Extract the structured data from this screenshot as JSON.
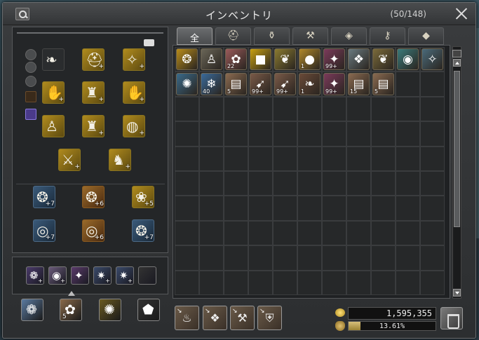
{
  "window": {
    "title": "インベントリ",
    "slot_count": "(50/148)"
  },
  "tabs": [
    {
      "label": "全",
      "icon": "all-tab",
      "active": true
    },
    {
      "label": "",
      "icon": "helmet-icon",
      "glyph": "⛑"
    },
    {
      "label": "",
      "icon": "potion-icon",
      "glyph": "⚱"
    },
    {
      "label": "",
      "icon": "hammer-icon",
      "glyph": "⚒"
    },
    {
      "label": "",
      "icon": "box-icon",
      "glyph": "◈"
    },
    {
      "label": "",
      "icon": "key-icon",
      "glyph": "⚷"
    },
    {
      "label": "",
      "icon": "diamond-icon",
      "glyph": "◆"
    }
  ],
  "inventory_items": [
    {
      "icon": "gold-pile-icon",
      "glyph": "❂",
      "color": "#b88c1a",
      "qty": ""
    },
    {
      "icon": "cloak-icon",
      "glyph": "♙",
      "color": "#6a6658",
      "qty": ""
    },
    {
      "icon": "rose-icon",
      "glyph": "✿",
      "color": "#9a5a5a",
      "qty": "22"
    },
    {
      "icon": "gold-cube-icon",
      "glyph": "■",
      "color": "#c8a010",
      "qty": ""
    },
    {
      "icon": "feather-icon",
      "glyph": "❦",
      "color": "#8a7a30",
      "qty": ""
    },
    {
      "icon": "egg-icon",
      "glyph": "●",
      "color": "#b0882a",
      "qty": "1"
    },
    {
      "icon": "crystal-scroll-icon",
      "glyph": "✦",
      "color": "#7a3a5a",
      "qty": "99+"
    },
    {
      "icon": "scroll-icon",
      "glyph": "❖",
      "color": "#6a7a80",
      "qty": ""
    },
    {
      "icon": "horn-icon",
      "glyph": "❦",
      "color": "#7a6a3a",
      "qty": ""
    },
    {
      "icon": "green-orb-icon",
      "glyph": "◉",
      "color": "#3a7a7a",
      "qty": ""
    },
    {
      "icon": "magic-wand-icon",
      "glyph": "✧",
      "color": "#4a6a7a",
      "qty": ""
    },
    {
      "icon": "pendant-icon",
      "glyph": "✺",
      "color": "#3a6a8a",
      "qty": ""
    },
    {
      "icon": "crystal-icon",
      "glyph": "❄",
      "color": "#3a6a9a",
      "qty": "40"
    },
    {
      "icon": "paper-icon",
      "glyph": "▤",
      "color": "#8a6a50",
      "qty": "5"
    },
    {
      "icon": "arrow-stick-icon",
      "glyph": "➹",
      "color": "#7a5a48",
      "qty": "99+"
    },
    {
      "icon": "arrow-stick-icon",
      "glyph": "➹",
      "color": "#7a5a48",
      "qty": "99+"
    },
    {
      "icon": "leaf-icon",
      "glyph": "❧",
      "color": "#6a4a38",
      "qty": "1"
    },
    {
      "icon": "crystal-scroll-icon",
      "glyph": "✦",
      "color": "#7a3a5a",
      "qty": "99+"
    },
    {
      "icon": "paper-icon",
      "glyph": "▤",
      "color": "#8a6a50",
      "qty": "15"
    },
    {
      "icon": "paper-icon",
      "glyph": "▤",
      "color": "#8a6a50",
      "qty": "5"
    }
  ],
  "equipment": [
    {
      "icon": "wings-icon",
      "glyph": "❧",
      "style": "empty",
      "tag": ""
    },
    {
      "icon": "helmet-icon",
      "glyph": "⛑",
      "style": "gold",
      "tag": "+"
    },
    {
      "icon": "shoulder-armor-icon",
      "glyph": "✧",
      "style": "gold",
      "tag": "+"
    },
    {
      "icon": "gloves-icon",
      "glyph": "✋",
      "style": "gold",
      "tag": "+"
    },
    {
      "icon": "chest-armor-icon",
      "glyph": "♜",
      "style": "gold",
      "tag": "+"
    },
    {
      "icon": "bracer-icon",
      "glyph": "✋",
      "style": "gold",
      "tag": "+"
    },
    {
      "icon": "cloak-icon",
      "glyph": "♙",
      "style": "gold",
      "tag": ""
    },
    {
      "icon": "leg-armor-icon",
      "glyph": "♜",
      "style": "gold",
      "tag": "+"
    },
    {
      "icon": "belt-icon",
      "glyph": "◍",
      "style": "gold",
      "tag": "+"
    },
    {
      "icon": "greatsword-icon",
      "glyph": "⚔",
      "style": "gold",
      "tag": "+"
    },
    {
      "icon": "boots-icon",
      "glyph": "♞",
      "style": "gold",
      "tag": "+"
    },
    {
      "icon": "earring-icon",
      "glyph": "❂",
      "style": "blue",
      "tag": "+7"
    },
    {
      "icon": "earring-icon",
      "glyph": "❂",
      "style": "orange",
      "tag": "+6"
    },
    {
      "icon": "shirt-icon",
      "glyph": "❀",
      "style": "gold",
      "tag": "+5"
    },
    {
      "icon": "ring-icon",
      "glyph": "◎",
      "style": "blue",
      "tag": "+7"
    },
    {
      "icon": "ring-icon",
      "glyph": "◎",
      "style": "orange",
      "tag": "+6"
    },
    {
      "icon": "necklace-icon",
      "glyph": "❂",
      "style": "blue",
      "tag": "+7"
    }
  ],
  "hotbar": [
    {
      "icon": "book-icon",
      "glyph": "❁",
      "color": "#4a3a6a",
      "tag": "+"
    },
    {
      "icon": "orb-icon",
      "glyph": "◉",
      "color": "#6a5a7a",
      "tag": "+"
    },
    {
      "icon": "crystal-icon",
      "glyph": "✦",
      "color": "#5a3a6a",
      "tag": ""
    },
    {
      "icon": "rune-icon",
      "glyph": "✷",
      "color": "#3a4a6a",
      "tag": "+"
    },
    {
      "icon": "rune-icon",
      "glyph": "✷",
      "color": "#3a4a6a",
      "tag": "+"
    },
    {
      "icon": "empty-slot-icon",
      "glyph": "",
      "color": "#333",
      "tag": ""
    }
  ],
  "consumables": [
    {
      "icon": "flower-icon",
      "glyph": "❁",
      "color": "#5a7aa0",
      "tag": ""
    },
    {
      "icon": "food-icon",
      "glyph": "✿",
      "color": "#8a6a4a",
      "tag": "5"
    },
    {
      "icon": "gold-ring-icon",
      "glyph": "✺",
      "color": "#6a5a20",
      "tag": ""
    },
    {
      "icon": "stone-icon",
      "glyph": "⬟",
      "color": "#333",
      "tag": ""
    }
  ],
  "actions": [
    {
      "icon": "pot-icon",
      "glyph": "♨"
    },
    {
      "icon": "gift-box-icon",
      "glyph": "❖"
    },
    {
      "icon": "anvil-icon",
      "glyph": "⚒"
    },
    {
      "icon": "shield-icon",
      "glyph": "⛨"
    }
  ],
  "currency": {
    "gold": "1,595,355",
    "weight_text": "13.61%",
    "weight_fraction": 0.1361
  }
}
